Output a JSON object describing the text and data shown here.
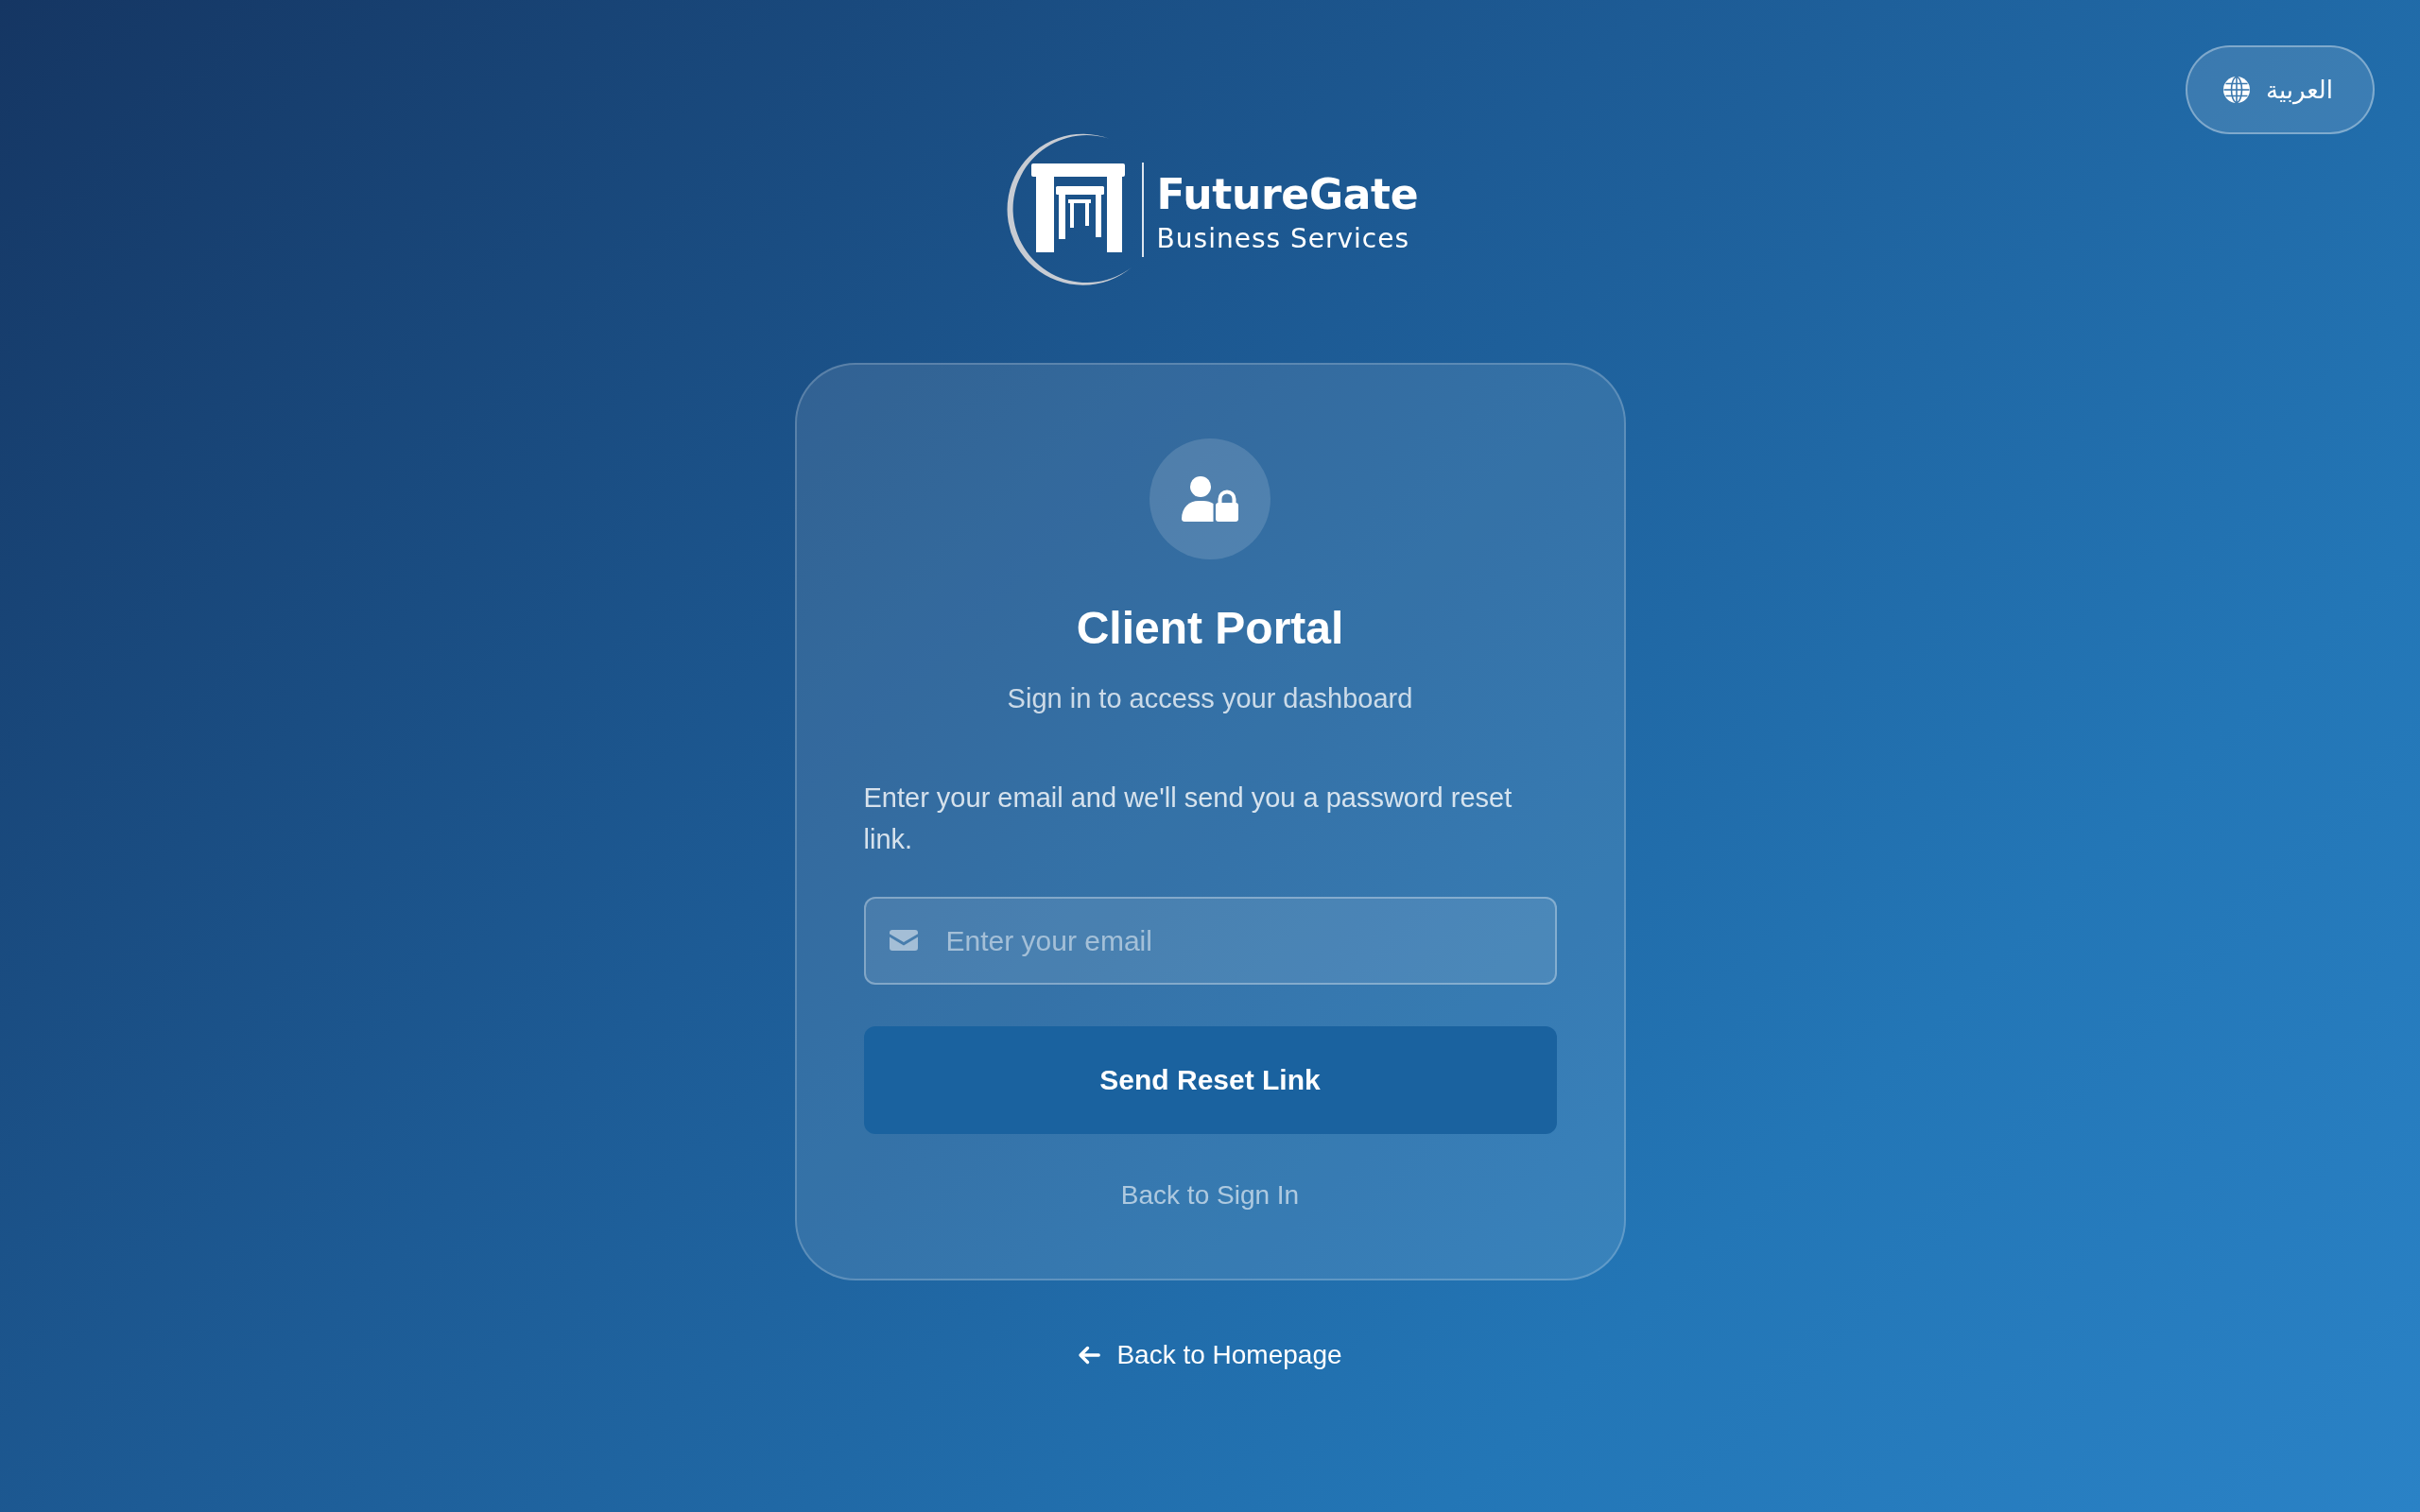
{
  "language_toggle": {
    "label": "العربية"
  },
  "brand": {
    "name": "FutureGate",
    "tagline": "Business Services"
  },
  "card": {
    "title": "Client Portal",
    "subtitle": "Sign in to access your dashboard",
    "instructions": "Enter your email and we'll send you a password reset link.",
    "email_field": {
      "placeholder": "Enter your email"
    },
    "submit_button": {
      "label": "Send Reset Link"
    },
    "back_link": {
      "label": "Back to Sign In"
    }
  },
  "homepage_link": {
    "label": "Back to Homepage"
  }
}
